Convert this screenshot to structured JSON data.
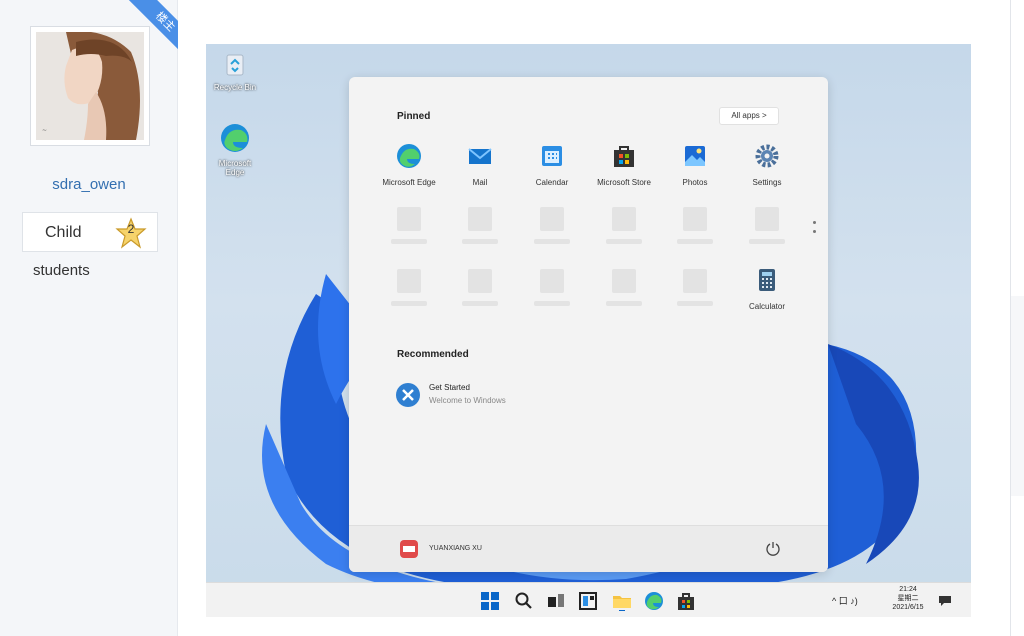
{
  "forum": {
    "username": "sdra_owen",
    "op_badge": "楼主",
    "user_group": "Child",
    "level": "2",
    "role": "students"
  },
  "desktop": {
    "icons": [
      {
        "label": "Recycle Bin",
        "icon": "recycle-bin-icon"
      },
      {
        "label": "Microsoft Edge",
        "icon": "edge-icon"
      }
    ]
  },
  "start_menu": {
    "pinned_heading": "Pinned",
    "all_apps_label": "All apps  >",
    "pinned_apps": [
      {
        "label": "Microsoft Edge",
        "icon": "edge-icon"
      },
      {
        "label": "Mail",
        "icon": "mail-icon"
      },
      {
        "label": "Calendar",
        "icon": "calendar-icon"
      },
      {
        "label": "Microsoft Store",
        "icon": "store-icon"
      },
      {
        "label": "Photos",
        "icon": "photos-icon"
      },
      {
        "label": "Settings",
        "icon": "settings-icon"
      }
    ],
    "row3_app": {
      "label": "Calculator",
      "icon": "calculator-icon"
    },
    "recommended_heading": "Recommended",
    "recommended": [
      {
        "title": "Get Started",
        "subtitle": "Welcome to Windows",
        "icon": "get-started-icon"
      }
    ],
    "user_name": "YUANXIANG XU"
  },
  "taskbar": {
    "time": "21:24",
    "weekday": "星期二",
    "date": "2021/6/15",
    "tray": "^ 口 ♪)",
    "colors": {
      "accent": "#0067c0",
      "taskbar": "#f2f2f2"
    }
  }
}
